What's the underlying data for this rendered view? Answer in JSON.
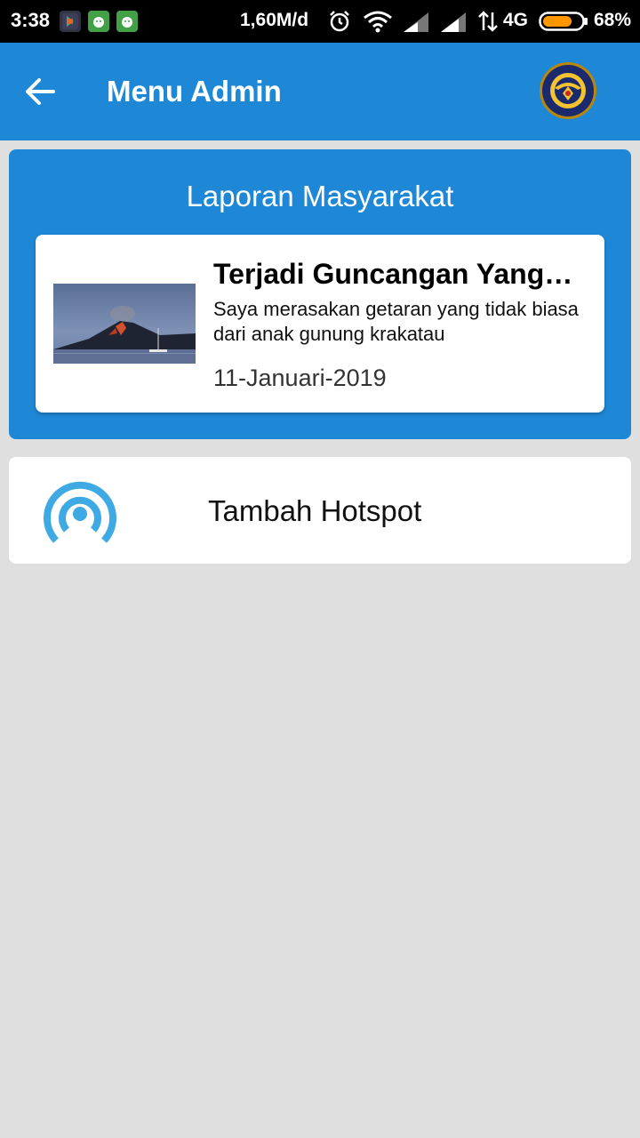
{
  "status_bar": {
    "time": "3:38",
    "speed": "1,60M/d",
    "network": "4G",
    "battery": "68%",
    "icons": [
      "google-play-games-icon",
      "android-icon",
      "android-icon",
      "alarm-icon",
      "wifi-icon",
      "signal-icon",
      "signal-icon",
      "data-arrows-icon",
      "battery-icon"
    ]
  },
  "app_bar": {
    "title": "Menu Admin",
    "back_icon": "arrow-left-icon",
    "logo_icon": "emblem-logo-icon"
  },
  "report_section": {
    "title": "Laporan Masyarakat",
    "report": {
      "title": "Terjadi Guncangan Yang…",
      "description": "Saya merasakan getaran yang tidak biasa dari anak gunung krakatau",
      "date": "11-Januari-2019",
      "thumbnail": "volcano-photo"
    }
  },
  "hotspot_card": {
    "label": "Tambah Hotspot",
    "icon": "hotspot-icon"
  },
  "colors": {
    "primary": "#1e88d7",
    "background": "#e0dfe0",
    "hotspot_icon": "#3fa9e4"
  }
}
